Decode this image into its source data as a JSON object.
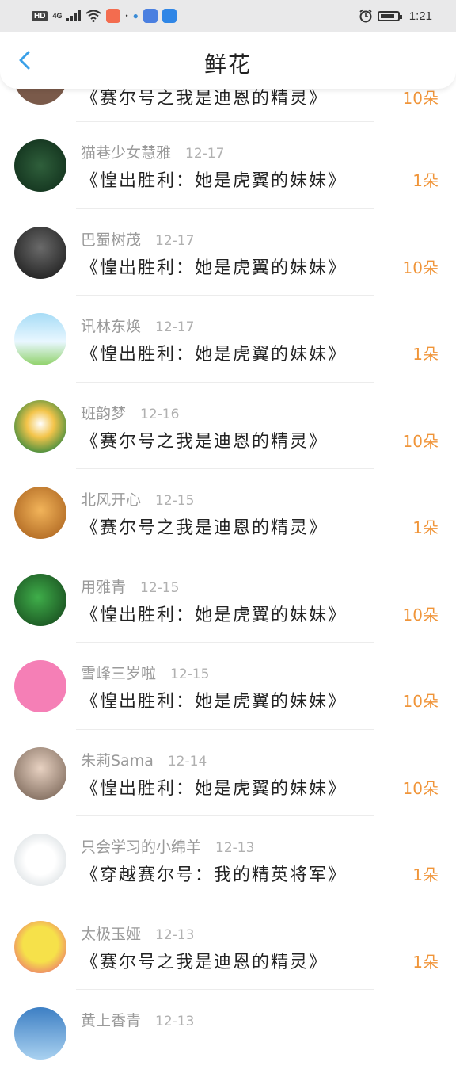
{
  "status_bar": {
    "hd": "HD",
    "network": "4G",
    "time": "1:21"
  },
  "header": {
    "title": "鲜花",
    "back_icon": "chevron-left-icon"
  },
  "colors": {
    "accent": "#3aa0e8",
    "count": "#f0953a"
  },
  "entries": [
    {
      "name": "",
      "date": "",
      "book": "《赛尔号之我是迪恩的精灵》",
      "count": "10朵"
    },
    {
      "name": "猫巷少女慧雅",
      "date": "12-17",
      "book": "《惶出胜利：她是虎翼的妹妹》",
      "count": "1朵"
    },
    {
      "name": "巴蜀树茂",
      "date": "12-17",
      "book": "《惶出胜利：她是虎翼的妹妹》",
      "count": "10朵"
    },
    {
      "name": "讯林东焕",
      "date": "12-17",
      "book": "《惶出胜利：她是虎翼的妹妹》",
      "count": "1朵"
    },
    {
      "name": "班韵梦",
      "date": "12-16",
      "book": "《赛尔号之我是迪恩的精灵》",
      "count": "10朵"
    },
    {
      "name": "北风开心",
      "date": "12-15",
      "book": "《赛尔号之我是迪恩的精灵》",
      "count": "1朵"
    },
    {
      "name": "用雅青",
      "date": "12-15",
      "book": "《惶出胜利：她是虎翼的妹妹》",
      "count": "10朵"
    },
    {
      "name": "雪峰三岁啦",
      "date": "12-15",
      "book": "《惶出胜利：她是虎翼的妹妹》",
      "count": "10朵"
    },
    {
      "name": "朱莉Sama",
      "date": "12-14",
      "book": "《惶出胜利：她是虎翼的妹妹》",
      "count": "10朵"
    },
    {
      "name": "只会学习的小绵羊",
      "date": "12-13",
      "book": "《穿越赛尔号：我的精英将军》",
      "count": "1朵"
    },
    {
      "name": "太极玉娅",
      "date": "12-13",
      "book": "《赛尔号之我是迪恩的精灵》",
      "count": "1朵"
    },
    {
      "name": "黄上香青",
      "date": "12-13",
      "book": "",
      "count": ""
    }
  ]
}
